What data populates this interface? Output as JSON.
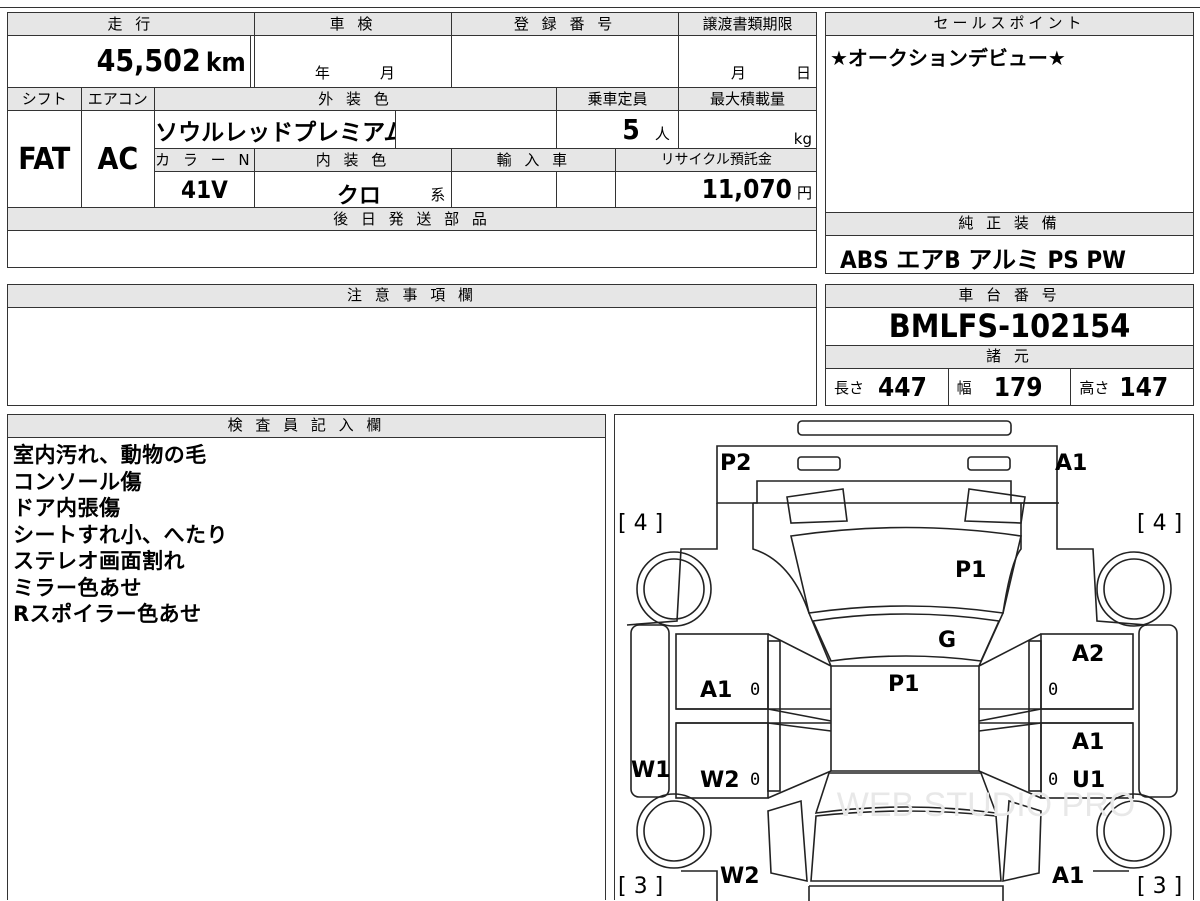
{
  "top": {
    "mileage_label": "走 行",
    "mileage": "45,502",
    "mileage_unit": "km",
    "shaken_label": "車 検",
    "shaken_year": "年",
    "shaken_month": "月",
    "reg_label": "登 録 番 号",
    "reg_value": "",
    "transfer_label": "譲渡書類期限",
    "transfer_month": "月",
    "transfer_day": "日"
  },
  "row2": {
    "shift_label": "シフト",
    "shift": "FAT",
    "ac_label": "エアコン",
    "ac": "AC",
    "color_label": "外 装 色",
    "color": "ソウルレッドプレミアム",
    "capacity_label": "乗車定員",
    "capacity": "5",
    "capacity_unit": "人",
    "maxload_label": "最大積載量",
    "maxload_unit": "kg",
    "colorno_label": "カ ラ ー N o .",
    "colorno": "41V",
    "interior_label": "内 装 色",
    "interior": "クロ",
    "interior_suffix": "系",
    "import_label": "輸 入 車",
    "recycle_label": "リサイクル預託金",
    "recycle": "11,070",
    "recycle_unit": "円"
  },
  "later_parts_label": "後 日 発 送 部 品",
  "sales": {
    "label": "セールスポイント",
    "text": "★オークションデビュー★"
  },
  "equipment": {
    "label": "純 正 装 備",
    "text": "ABS エアB アルミ PS PW"
  },
  "caution_label": "注 意 事 項 欄",
  "chassis": {
    "label": "車 台 番 号",
    "value": "BMLFS-102154",
    "spec_label": "諸 元",
    "length_label": "長さ",
    "length": "447",
    "width_label": "幅",
    "width": "179",
    "height_label": "高さ",
    "height": "147"
  },
  "inspector": {
    "label": "検 査 員 記 入 欄",
    "notes": [
      "室内汚れ、動物の毛",
      "コンソール傷",
      "ドア内張傷",
      "シートすれ小、へたり",
      "ステレオ画面割れ",
      "ミラー色あせ",
      "Rスポイラー色あせ"
    ]
  },
  "diagram": {
    "marks": {
      "p2": "P2",
      "a1_top": "A1",
      "tire_fl": "[ 4 ]",
      "tire_fr": "[ 4 ]",
      "p1_hood": "P1",
      "g": "G",
      "a2": "A2",
      "a1_left_door": "A1",
      "p1_roof": "P1",
      "a1_right": "A1",
      "w1": "W1",
      "w2_left": "W2",
      "u1": "U1",
      "w2_bottom": "W2",
      "a1_bottom": "A1",
      "tire_rl": "[ 3 ]",
      "tire_rr": "[ 3 ]",
      "z1": "0",
      "z2": "0",
      "z3": "0",
      "z4": "0"
    },
    "watermark": "WEB STUDIO PRO"
  }
}
